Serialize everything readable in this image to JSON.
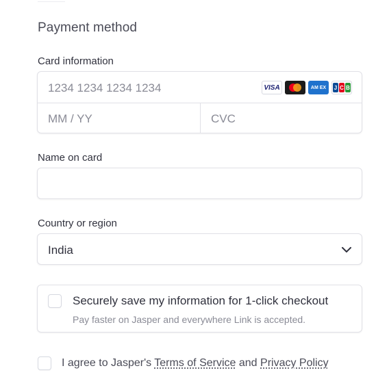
{
  "payment": {
    "section_title": "Payment method",
    "card_label": "Card information",
    "card_number_placeholder": "1234 1234 1234 1234",
    "expiry_placeholder": "MM / YY",
    "cvc_placeholder": "CVC",
    "brands": [
      "visa-icon",
      "mastercard-icon",
      "amex-icon",
      "jcb-icon"
    ],
    "visa_text": "VISA",
    "amex_text": "AM EX",
    "jcb_letters": [
      "J",
      "C",
      "B"
    ],
    "name_label": "Name on card",
    "name_value": "",
    "country_label": "Country or region",
    "country_value": "India"
  },
  "link": {
    "title": "Securely save my information for 1-click checkout",
    "subtitle": "Pay faster on Jasper and everywhere Link is accepted."
  },
  "terms": {
    "prefix": "I agree to Jasper's ",
    "tos": "Terms of Service",
    "and": " and ",
    "privacy": "Privacy Policy"
  },
  "colors": {
    "border": "#e0e0e6",
    "text": "#30313d",
    "placeholder": "#8a8b96"
  }
}
